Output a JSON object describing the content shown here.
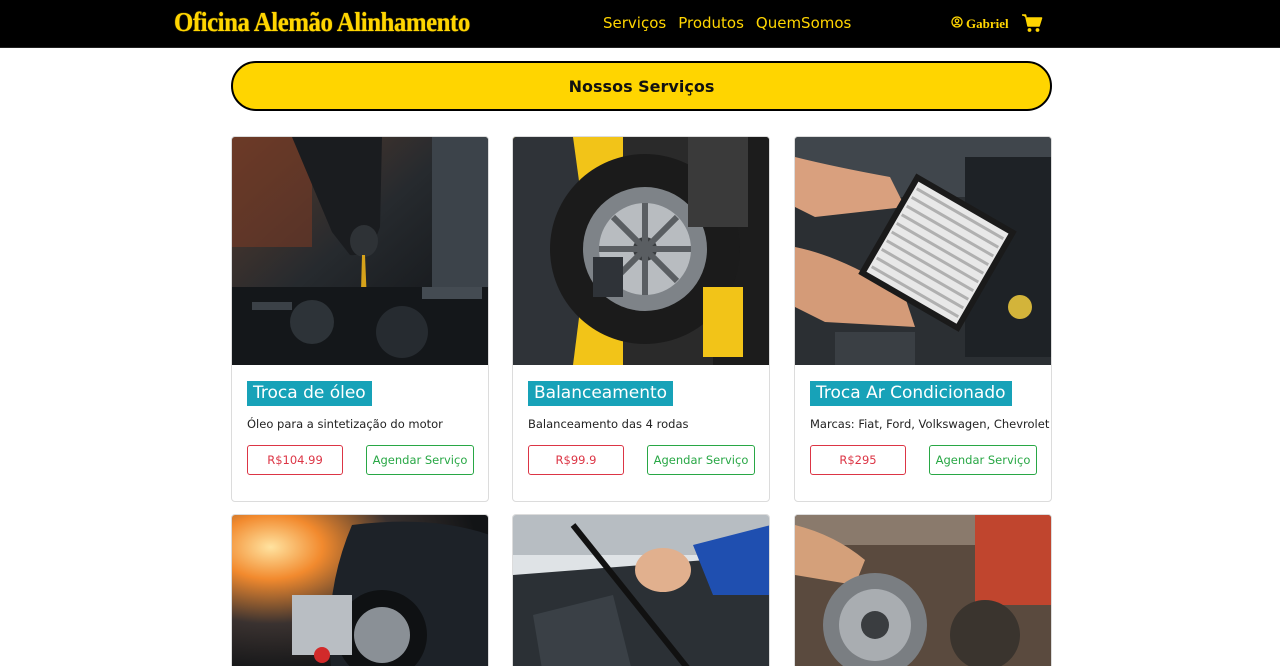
{
  "header": {
    "brand": "Oficina Alemão Alinhamento",
    "nav": [
      "Serviços",
      "Produtos",
      "QuemSomos"
    ],
    "user_name": "Gabriel",
    "icons": {
      "user": "user-circle-icon",
      "cart": "shopping-cart-icon"
    },
    "colors": {
      "bar": "#000000",
      "accent": "#ffd500"
    }
  },
  "section": {
    "title": "Nossos Serviços"
  },
  "services": [
    {
      "title": "Troca de óleo",
      "description": "Óleo para a sintetização do motor",
      "price": "R$104.99",
      "action": "Agendar Serviço",
      "image": "oil-change-photo"
    },
    {
      "title": "Balanceamento",
      "description": "Balanceamento das 4 rodas",
      "price": "R$99.9",
      "action": "Agendar Serviço",
      "image": "wheel-balancing-photo"
    },
    {
      "title": "Troca Ar Condicionado",
      "description": "Marcas: Fiat, Ford, Volkswagen, Chevrolet",
      "price": "R$295",
      "action": "Agendar Serviço",
      "image": "air-filter-photo"
    }
  ],
  "more_service_images": [
    "wheel-alignment-photo",
    "windshield-wiper-photo",
    "clutch-repair-photo"
  ],
  "colors": {
    "title_badge": "#17a2b8",
    "price": "#dc3545",
    "book": "#28a745"
  }
}
